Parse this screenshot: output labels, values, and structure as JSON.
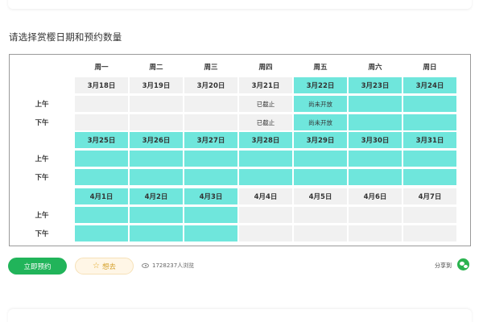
{
  "section_title": "请选择赏樱日期和预约数量",
  "calendar": {
    "weekdays": [
      "周一",
      "周二",
      "周三",
      "周四",
      "周五",
      "周六",
      "周日"
    ],
    "slot_labels": [
      "上午",
      "下午"
    ],
    "weeks": [
      {
        "dates": [
          {
            "label": "3月18日",
            "state": "unavailable"
          },
          {
            "label": "3月19日",
            "state": "unavailable"
          },
          {
            "label": "3月20日",
            "state": "unavailable"
          },
          {
            "label": "3月21日",
            "state": "unavailable"
          },
          {
            "label": "3月22日",
            "state": "available"
          },
          {
            "label": "3月23日",
            "state": "available"
          },
          {
            "label": "3月24日",
            "state": "available"
          }
        ],
        "slots": [
          [
            {
              "text": "",
              "state": "unavailable"
            },
            {
              "text": "",
              "state": "unavailable"
            },
            {
              "text": "",
              "state": "unavailable"
            },
            {
              "text": "已截止",
              "state": "unavailable"
            },
            {
              "text": "尚未开放",
              "state": "available"
            },
            {
              "text": "",
              "state": "available"
            },
            {
              "text": "",
              "state": "available"
            }
          ],
          [
            {
              "text": "",
              "state": "unavailable"
            },
            {
              "text": "",
              "state": "unavailable"
            },
            {
              "text": "",
              "state": "unavailable"
            },
            {
              "text": "已截止",
              "state": "unavailable"
            },
            {
              "text": "尚未开放",
              "state": "available"
            },
            {
              "text": "",
              "state": "available"
            },
            {
              "text": "",
              "state": "available"
            }
          ]
        ]
      },
      {
        "dates": [
          {
            "label": "3月25日",
            "state": "available"
          },
          {
            "label": "3月26日",
            "state": "available"
          },
          {
            "label": "3月27日",
            "state": "available"
          },
          {
            "label": "3月28日",
            "state": "available"
          },
          {
            "label": "3月29日",
            "state": "available"
          },
          {
            "label": "3月30日",
            "state": "available"
          },
          {
            "label": "3月31日",
            "state": "available"
          }
        ],
        "slots": [
          [
            {
              "text": "",
              "state": "available"
            },
            {
              "text": "",
              "state": "available"
            },
            {
              "text": "",
              "state": "available"
            },
            {
              "text": "",
              "state": "available"
            },
            {
              "text": "",
              "state": "available"
            },
            {
              "text": "",
              "state": "available"
            },
            {
              "text": "",
              "state": "available"
            }
          ],
          [
            {
              "text": "",
              "state": "available"
            },
            {
              "text": "",
              "state": "available"
            },
            {
              "text": "",
              "state": "available"
            },
            {
              "text": "",
              "state": "available"
            },
            {
              "text": "",
              "state": "available"
            },
            {
              "text": "",
              "state": "available"
            },
            {
              "text": "",
              "state": "available"
            }
          ]
        ]
      },
      {
        "dates": [
          {
            "label": "4月1日",
            "state": "available"
          },
          {
            "label": "4月2日",
            "state": "available"
          },
          {
            "label": "4月3日",
            "state": "available"
          },
          {
            "label": "4月4日",
            "state": "unavailable"
          },
          {
            "label": "4月5日",
            "state": "unavailable"
          },
          {
            "label": "4月6日",
            "state": "unavailable"
          },
          {
            "label": "4月7日",
            "state": "unavailable"
          }
        ],
        "slots": [
          [
            {
              "text": "",
              "state": "available"
            },
            {
              "text": "",
              "state": "available"
            },
            {
              "text": "",
              "state": "available"
            },
            {
              "text": "",
              "state": "unavailable"
            },
            {
              "text": "",
              "state": "unavailable"
            },
            {
              "text": "",
              "state": "unavailable"
            },
            {
              "text": "",
              "state": "unavailable"
            }
          ],
          [
            {
              "text": "",
              "state": "available"
            },
            {
              "text": "",
              "state": "available"
            },
            {
              "text": "",
              "state": "available"
            },
            {
              "text": "",
              "state": "unavailable"
            },
            {
              "text": "",
              "state": "unavailable"
            },
            {
              "text": "",
              "state": "unavailable"
            },
            {
              "text": "",
              "state": "unavailable"
            }
          ]
        ]
      }
    ]
  },
  "actions": {
    "book_label": "立即预约",
    "want_label": "想去",
    "want_icon": "star-icon",
    "view_count": "1728237人浏览",
    "view_icon": "eye-icon",
    "share_label": "分享到",
    "share_icon": "wechat-icon"
  },
  "colors": {
    "available": "#6fe6dc",
    "unavailable": "#f1f1f1",
    "primary_button": "#21b45a",
    "want_button": "#fff6e6",
    "wechat": "#2ab34f"
  }
}
